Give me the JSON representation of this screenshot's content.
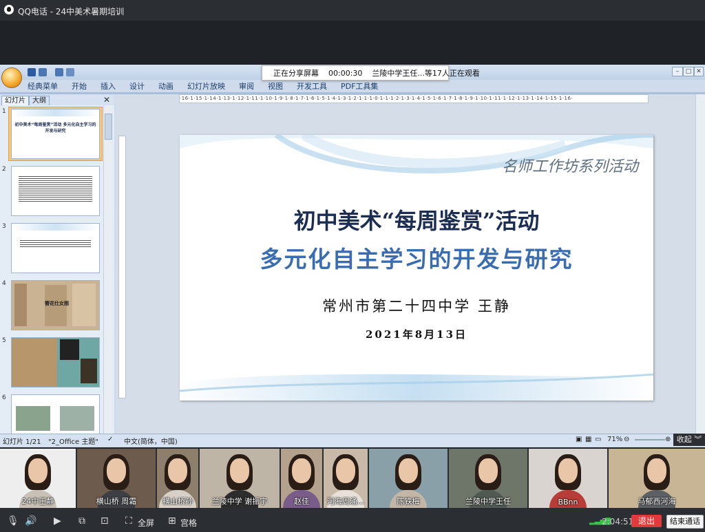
{
  "qq": {
    "app_title": "QQ电话",
    "group_title": "24中美术暑期培训",
    "title_separator": "-"
  },
  "share_banner": {
    "status": "正在分享屏幕",
    "timer": "00:00:30",
    "viewers": "兰陵中学王任...等17人正在观看"
  },
  "ppt": {
    "ribbon_tabs": [
      "经典菜单",
      "开始",
      "插入",
      "设计",
      "动画",
      "幻灯片放映",
      "审阅",
      "视图",
      "开发工具",
      "PDF工具集"
    ],
    "pane_tabs": [
      "幻灯片",
      "大纲"
    ],
    "thumbs": [
      {
        "num": "1",
        "text": "初中美术“每周鉴赏”活动 多元化自主学习的开发与研究"
      },
      {
        "num": "2",
        "text": ""
      },
      {
        "num": "3",
        "text": ""
      },
      {
        "num": "4",
        "text": "簪花仕女图"
      },
      {
        "num": "5",
        "text": ""
      },
      {
        "num": "6",
        "text": ""
      }
    ],
    "ruler_text": "·16·1·15·1·14·1·13·1·12·1·11·1·10·1·9·1·8·1·7·1·6·1·5·1·4·1·3·1·2·1·1·1·0·1·1·1·2·1·3·1·4·1·5·1·6·1·7·1·8·1·9·1·10·1·11·1·12·1·13·1·14·1·15·1·16·",
    "slide": {
      "series": "名师工作坊系列活动",
      "title": "初中美术“每周鉴赏”活动",
      "subtitle": "多元化自主学习的开发与研究",
      "author": "常州市第二十四中学  王静",
      "date": "2021年8月13日"
    },
    "status": {
      "slide_count": "幻灯片 1/21",
      "theme": "\"2_Office 主题\"",
      "language": "中文(简体，中国)",
      "zoom": "71%"
    }
  },
  "collapse_label": "收起",
  "participants": [
    {
      "name": "24中王静",
      "shirt": "#c9c0b6",
      "bg": "#eeeeee"
    },
    {
      "name": "横山桥 周霜",
      "shirt": "#3d3f44",
      "bg": "#6d5c4d"
    },
    {
      "name": "横山桥孙",
      "shirt": "#d8d0c8",
      "bg": "#8d7f6c"
    },
    {
      "name": "兰陵中学 谢振宇",
      "shirt": "#2d2d2d",
      "bg": "#bfb5a6"
    },
    {
      "name": "赵佳",
      "shirt": "#7a5c8a",
      "bg": "#b4a28e"
    },
    {
      "name": "河海周涌...",
      "shirt": "#e7e1da",
      "bg": "#c8b9a8"
    },
    {
      "name": "陈铁梅",
      "shirt": "#c2b6a7",
      "bg": "#8aa0a8"
    },
    {
      "name": "兰陵中学王任",
      "shirt": "#505a52",
      "bg": "#6e766a"
    },
    {
      "name": "BBnn",
      "shirt": "#b83c37",
      "bg": "#d9d4cf"
    },
    {
      "name": "马郁西河海",
      "shirt": "#5c5f63",
      "bg": "#c7b595"
    }
  ],
  "toolbar": {
    "fullscreen": "全屏",
    "grid": "宫格",
    "duration": "2:04:51",
    "exit": "退出",
    "end_call": "结束通话"
  }
}
